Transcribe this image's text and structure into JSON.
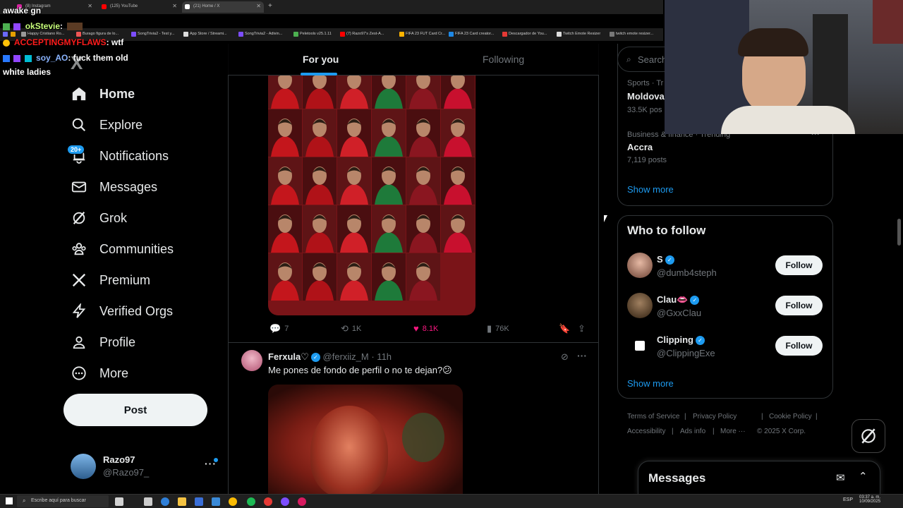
{
  "browser": {
    "tabs": [
      {
        "label": "(8) Instagram",
        "color": "#d6249f"
      },
      {
        "label": "(125) YouTube",
        "color": "#ff0000"
      },
      {
        "label": "(21) Home / X",
        "color": "#ffffff"
      }
    ],
    "new_tab": "+",
    "bookmarks": [
      "Happy Cristiano Ro...",
      "Burago figura de lo...",
      "SongTrivia2 - Test y...",
      "App Store / Streami...",
      "SongTrivia2 - Adivin...",
      "Peletools v25.1.11",
      "(7) Razo97's Zest-A...",
      "FIFA 23 FUT Card Cr...",
      "FIFA 23 Card creator...",
      "Descargador de You...",
      "Twitch Emote Resizer",
      "twitch emote resizer..."
    ]
  },
  "chat_overlay": [
    {
      "text": "awake gn"
    },
    {
      "user": "okStevie",
      "message": ":"
    },
    {
      "user": "ACCEPTINGMYFLAWS",
      "message": ": wtf"
    },
    {
      "user": "soy_AO",
      "message": ": fuck them old"
    },
    {
      "text": "white ladies"
    }
  ],
  "nav": {
    "logo": "X",
    "items": [
      {
        "label": "Home",
        "icon": "home-icon"
      },
      {
        "label": "Explore",
        "icon": "search-icon"
      },
      {
        "label": "Notifications",
        "icon": "bell-icon"
      },
      {
        "label": "Messages",
        "icon": "envelope-icon"
      },
      {
        "label": "Grok",
        "icon": "grok-icon"
      },
      {
        "label": "Communities",
        "icon": "people-icon"
      },
      {
        "label": "Premium",
        "icon": "x-logo-icon"
      },
      {
        "label": "Verified Orgs",
        "icon": "lightning-icon"
      },
      {
        "label": "Profile",
        "icon": "person-icon"
      },
      {
        "label": "More",
        "icon": "more-circle-icon"
      }
    ],
    "notifications_badge": "20+",
    "post_label": "Post",
    "account": {
      "name": "Razo97",
      "handle": "@Razo97_"
    }
  },
  "feed": {
    "tabs": [
      "For you",
      "Following"
    ],
    "tweet1": {
      "replies": "7",
      "reposts": "1K",
      "likes": "8.1K",
      "views": "76K"
    },
    "tweet2": {
      "name": "Ferxula♡",
      "handle": "@ferxiiz_M",
      "time": "· 11h",
      "text": "Me pones de fondo de perfil o no te dejan?😕"
    }
  },
  "sidebar": {
    "search_placeholder": "Search",
    "trends": [
      {
        "category": "Sports · Tr",
        "topic": "Moldova",
        "posts": "33.5K pos"
      },
      {
        "category": "Business & finance · Trending",
        "topic": "Accra",
        "posts": "7,119 posts"
      }
    ],
    "show_more": "Show more",
    "who_to_follow_title": "Who to follow",
    "suggestions": [
      {
        "name": "S",
        "handle": "@dumb4steph",
        "follow": "Follow"
      },
      {
        "name": "Clau👄",
        "handle": "@GxxClau",
        "follow": "Follow"
      },
      {
        "name": "Clipping",
        "handle": "@ClippingExe",
        "follow": "Follow"
      }
    ],
    "show_more_2": "Show more",
    "footer": [
      "Terms of Service",
      "|",
      "Privacy Policy",
      "|",
      "Cookie Policy",
      "|",
      "Accessibility",
      "|",
      "Ads info",
      "|",
      "More ···",
      "© 2025 X Corp."
    ],
    "messages_title": "Messages"
  },
  "taskbar": {
    "search_placeholder": "Escribe aquí para buscar",
    "lang": "ESP",
    "time": "03:37 a. m.",
    "date": "10/09/2025"
  }
}
